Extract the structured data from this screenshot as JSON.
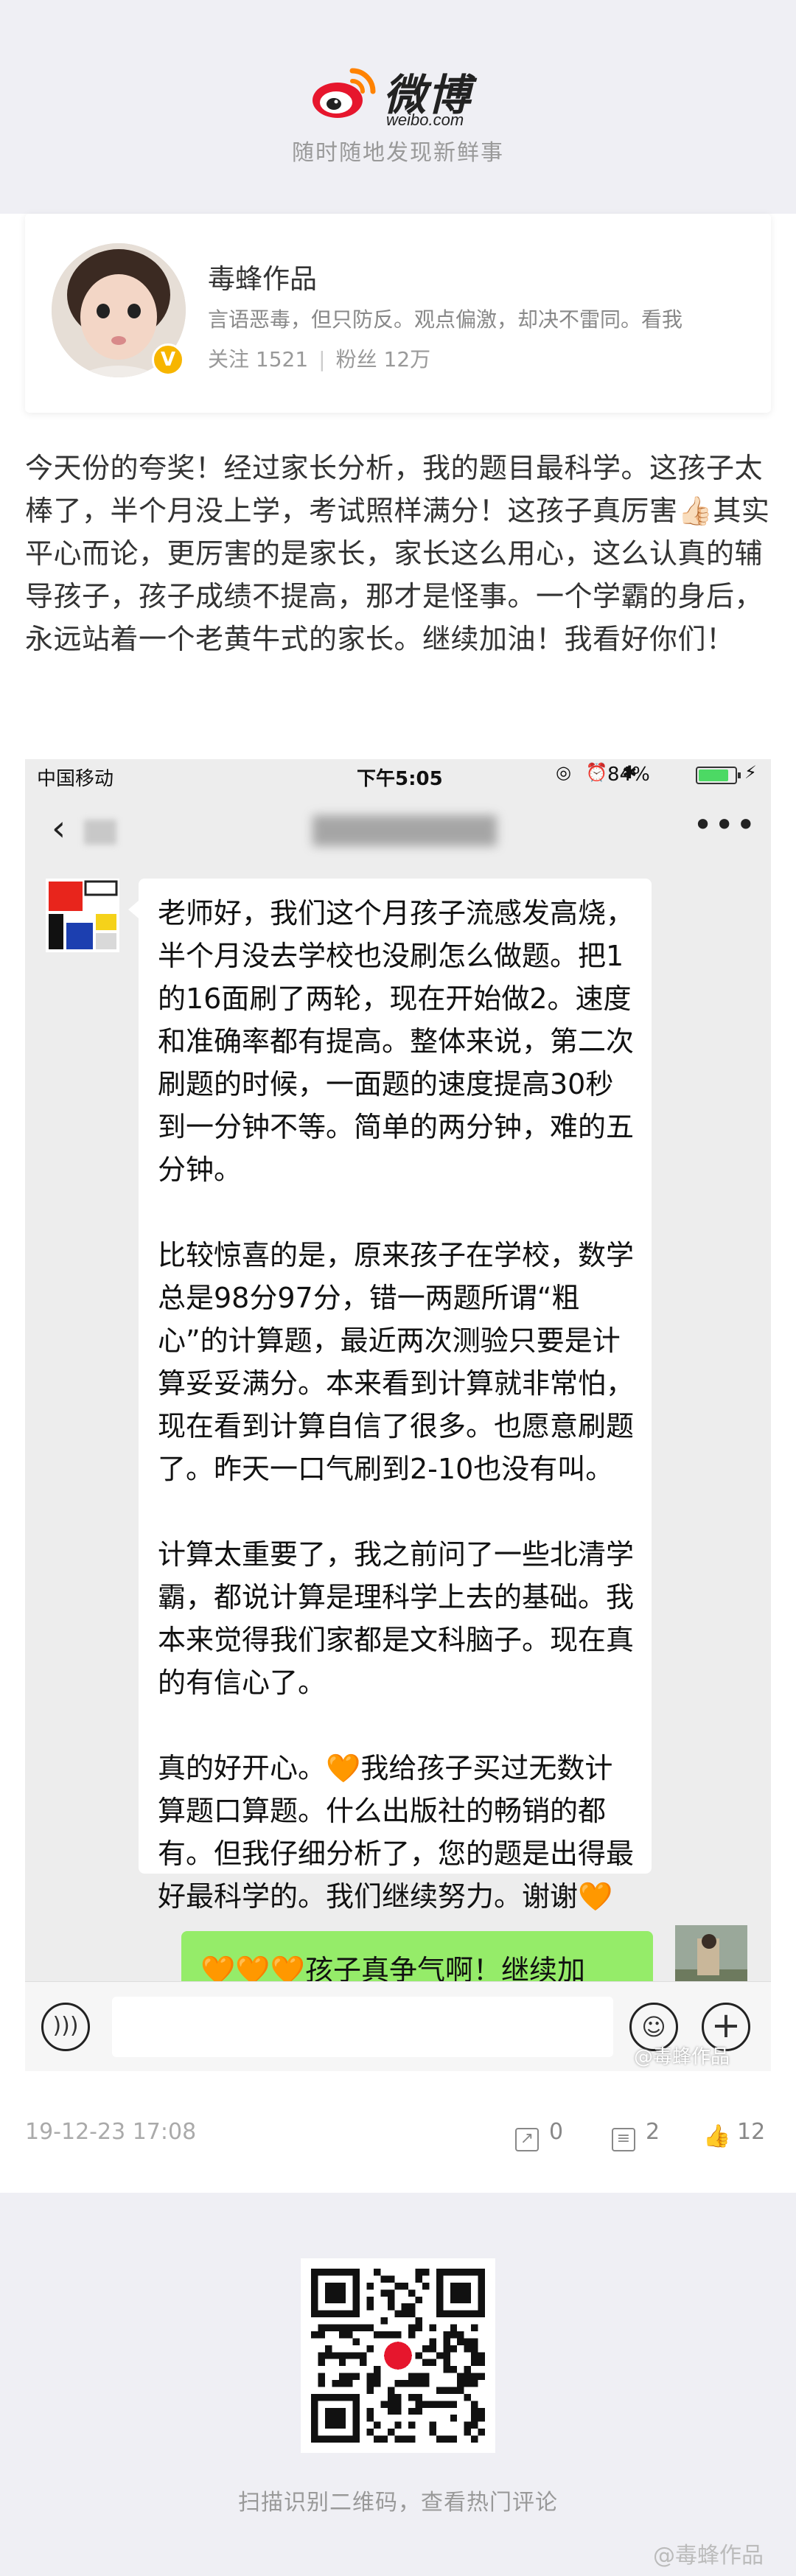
{
  "brand": {
    "logo_text": "微博",
    "logo_sub": "weibo.com",
    "tagline": "随时随地发现新鲜事"
  },
  "profile": {
    "name": "毒蜂作品",
    "verified_badge": "V",
    "description": "言语恶毒，但只防反。观点偏激，却决不雷同。看我",
    "following_label": "关注 1521",
    "followers_label": "粉丝 12万"
  },
  "post": {
    "text": "今天份的夸奖！经过家长分析，我的题目最科学。这孩子太棒了，半个月没上学，考试照样满分！这孩子真厉害👍🏻其实平心而论，更厉害的是家长，家长这么用心，这么认真的辅导孩子，孩子成绩不提高，那才是怪事。一个学霸的身后，永远站着一个老黄牛式的家长。继续加油！我看好你们！",
    "date": "19-12-23 17:08",
    "reposts": "0",
    "comments": "2",
    "likes": "12"
  },
  "screenshot": {
    "carrier": "中国移动",
    "time": "下午5:05",
    "battery_label": "84%",
    "battery_level": 0.84,
    "message_paragraphs": [
      "老师好，我们这个月孩子流感发高烧，半个月没去学校也没刷怎么做题。把1的16面刷了两轮，现在开始做2。速度和准确率都有提高。整体来说，第二次刷题的时候，一面题的速度提高30秒到一分钟不等。简单的两分钟，难的五分钟。",
      "比较惊喜的是，原来孩子在学校，数学总是98分97分，错一两题所谓“粗心”的计算题，最近两次测验只要是计算妥妥满分。本来看到计算就非常怕，现在看到计算自信了很多。也愿意刷题了。昨天一口气刷到2-10也没有叫。",
      "计算太重要了，我之前问了一些北清学霸，都说计算是理科学上去的基础。我本来觉得我们家都是文科脑子。现在真的有信心了。",
      "真的好开心。🧡我给孩子买过无数计算题口算题。什么出版社的畅销的都有。但我仔细分析了，您的题是出得最好最科学的。我们继续努力。谢谢🧡"
    ],
    "reply_text": "🧡🧡🧡孩子真争气啊！继续加",
    "watermark_corner": "@毒蜂作品"
  },
  "footer": {
    "qr_caption": "扫描识别二维码，查看热门评论",
    "watermark": "@毒蜂作品"
  },
  "colors": {
    "bubble_green": "#95ec69",
    "weibo_red": "#e6162d",
    "weibo_orange": "#ff8200",
    "badge_yellow": "#f7b500"
  }
}
